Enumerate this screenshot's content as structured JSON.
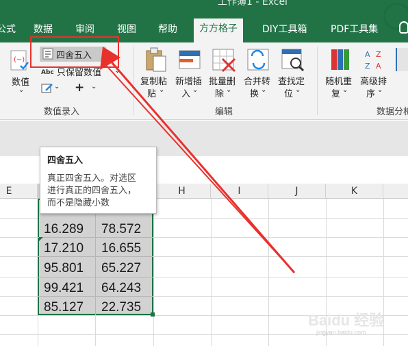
{
  "window": {
    "title": "工作簿1 - Excel"
  },
  "tabs": [
    {
      "label": "公式",
      "active": false
    },
    {
      "label": "数据",
      "active": false
    },
    {
      "label": "审阅",
      "active": false
    },
    {
      "label": "视图",
      "active": false
    },
    {
      "label": "帮助",
      "active": false
    },
    {
      "label": "方方格子",
      "active": true
    },
    {
      "label": "DIY工具箱",
      "active": false
    },
    {
      "label": "PDF工具集",
      "active": false
    }
  ],
  "ribbon": {
    "value_btn": {
      "label": "数值",
      "caret": "⌄"
    },
    "round_btn": {
      "label": "四舍五入",
      "caret": "⌄"
    },
    "keep_value": {
      "badge": "Abc",
      "label": "只保留数值",
      "caret": "⌄"
    },
    "plus": {
      "label": "+",
      "caret": "⌄"
    },
    "group_numeric": "数值录入",
    "copy_paste": {
      "line1": "复制粘",
      "line2": "贴",
      "caret": "⌄"
    },
    "insert": {
      "line1": "新增插",
      "line2": "入",
      "caret": "⌄"
    },
    "batch_delete": {
      "line1": "批量删",
      "line2": "除",
      "caret": "⌄"
    },
    "merge": {
      "line1": "合并转",
      "line2": "换",
      "caret": "⌄"
    },
    "find": {
      "line1": "查找定",
      "line2": "位",
      "caret": "⌄"
    },
    "group_edit": "编辑",
    "random": {
      "line1": "随机重",
      "line2": "复",
      "caret": "⌄"
    },
    "sort": {
      "line1": "高级排",
      "line2": "序",
      "caret": "⌄"
    },
    "group_data": "数据分析"
  },
  "tooltip": {
    "title": "四舍五入",
    "lines": [
      "真正四舍五入。对选区",
      "进行真正的四舍五入，",
      "而不是隐藏小数"
    ]
  },
  "sheet": {
    "columns": [
      "E",
      "H",
      "I",
      "J",
      "K"
    ],
    "rows": [
      [
        "16.289",
        "78.572"
      ],
      [
        "17.210",
        "16.655"
      ],
      [
        "95.801",
        "65.227"
      ],
      [
        "99.421",
        "64.243"
      ],
      [
        "85.127",
        "22.735"
      ]
    ]
  },
  "watermark": {
    "text": "Baidu 经验",
    "sub": "jingyan.baidu.com"
  },
  "colors": {
    "accent": "#217346",
    "highlight": "#e8312d"
  }
}
